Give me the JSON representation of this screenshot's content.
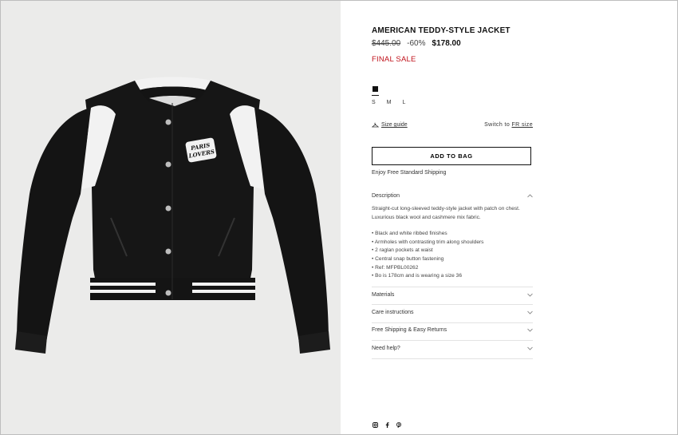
{
  "product": {
    "title": "AMERICAN TEDDY-STYLE JACKET",
    "old_price": "$445.00",
    "discount": "-60%",
    "price": "$178.00",
    "sale_label": "FINAL SALE",
    "patch_line1": "PARIS",
    "patch_line2": "LOVERS"
  },
  "colors": {
    "selected_swatch": "#111111",
    "sale": "#c0121b"
  },
  "sizes": [
    "S",
    "M",
    "L"
  ],
  "size_guide": {
    "icon": "hanger-icon",
    "label": "Size guide"
  },
  "switch": {
    "prefix": "Switch to",
    "link": "FR size"
  },
  "add_to_bag": "ADD TO BAG",
  "shipping_note": "Enjoy Free Standard Shipping",
  "description": {
    "heading": "Description",
    "text": "Straight-cut long-sleeved teddy-style jacket with patch on chest. Luxurious black wool and cashmere mix fabric.",
    "bullets": [
      "• Black and white ribbed finishes",
      "• Armholes with contrasting trim along shoulders",
      "• 2 raglan pockets at waist",
      "• Central snap button fastening",
      "• Ref: MFPBL00262",
      "• Bo is 178cm and is wearing a size 36"
    ]
  },
  "accordions": [
    "Materials",
    "Care instructions",
    "Free Shipping & Easy Returns",
    "Need help?"
  ],
  "social": [
    "instagram-icon",
    "facebook-icon",
    "pinterest-icon"
  ]
}
